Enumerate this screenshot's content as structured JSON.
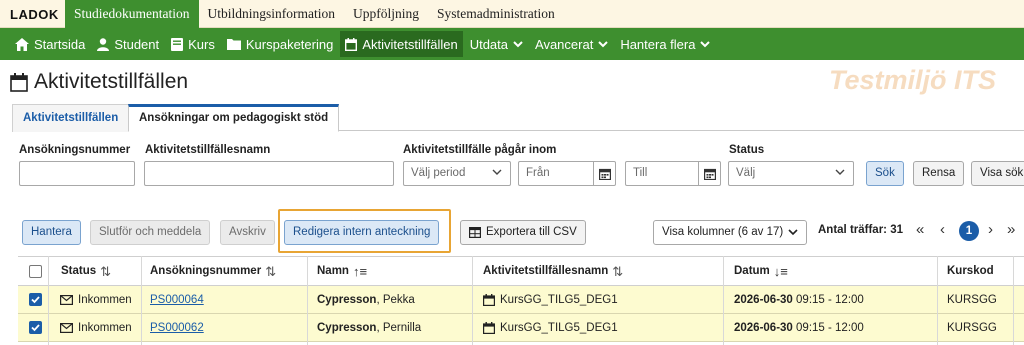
{
  "app": {
    "logo": "LADOK",
    "watermark": "Testmiljö ITS"
  },
  "topnav": [
    {
      "label": "Studiedokumentation",
      "active": true
    },
    {
      "label": "Utbildningsinformation",
      "active": false
    },
    {
      "label": "Uppföljning",
      "active": false
    },
    {
      "label": "Systemadministration",
      "active": false
    }
  ],
  "mainnav": {
    "startsida": "Startsida",
    "student": "Student",
    "kurs": "Kurs",
    "kurspaketering": "Kurspaketering",
    "aktivitetstillfallen": "Aktivitetstillfällen",
    "utdata": "Utdata",
    "avancerat": "Avancerat",
    "hantera_flera": "Hantera flera"
  },
  "page": {
    "title": "Aktivitetstillfällen"
  },
  "tabs": [
    {
      "label": "Aktivitetstillfällen",
      "active": false
    },
    {
      "label": "Ansökningar om pedagogiskt stöd",
      "active": true
    }
  ],
  "filters": {
    "ansokningsnummer_label": "Ansökningsnummer",
    "ansokningsnummer_value": "",
    "namn_label": "Aktivitetstillfällesnamn",
    "namn_value": "",
    "period_label": "Aktivitetstillfälle pågår inom",
    "period_select": "Välj period",
    "fran_placeholder": "Från",
    "till_placeholder": "Till",
    "status_label": "Status",
    "status_select": "Välj",
    "sok": "Sök",
    "rensa": "Rensa",
    "visa_sok": "Visa sök"
  },
  "actions": {
    "hantera": "Hantera",
    "slutfor": "Slutför och meddela",
    "avskriv": "Avskriv",
    "redigera": "Redigera intern anteckning",
    "exportera": "Exportera till CSV",
    "visa_kolumner": "Visa kolumner (6 av 17)",
    "antal_traffar_label": "Antal träffar: 31",
    "current_page": "1"
  },
  "table": {
    "headers": {
      "status": "Status",
      "ansokningsnummer": "Ansökningsnummer",
      "namn": "Namn",
      "aktivitetstillfallesnamn": "Aktivitetstillfällesnamn",
      "datum": "Datum",
      "kurskod": "Kurskod"
    },
    "rows": [
      {
        "checked": true,
        "status": "Inkommen",
        "ansokningsnummer": "PS000064",
        "efternamn": "Cypresson",
        "fornamn": ", Pekka",
        "aktivitet": "KursGG_TILG5_DEG1",
        "datum": "2026-06-30",
        "tid": " 09:15 - 12:00",
        "kurskod": "KURSGG"
      },
      {
        "checked": true,
        "status": "Inkommen",
        "ansokningsnummer": "PS000062",
        "efternamn": "Cypresson",
        "fornamn": ", Pernilla",
        "aktivitet": "KursGG_TILG5_DEG1",
        "datum": "2026-06-30",
        "tid": " 09:15 - 12:00",
        "kurskod": "KURSGG"
      }
    ]
  },
  "colors": {
    "brand_green": "#3e8f2f",
    "primary_blue": "#1b5da8",
    "highlight": "#e8a534",
    "selected_row": "#fdfbd0"
  }
}
